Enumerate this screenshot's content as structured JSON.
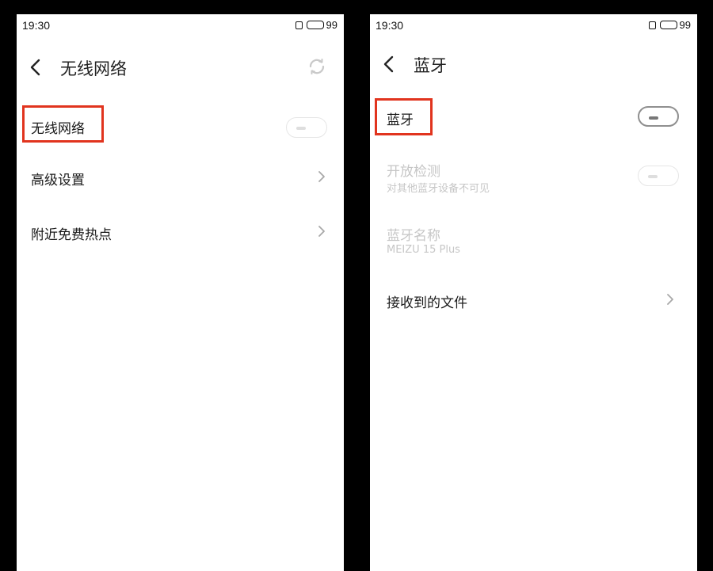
{
  "left_screen": {
    "status_bar": {
      "time": "19:30",
      "battery": "99"
    },
    "title": "无线网络",
    "rows": {
      "wifi_toggle_label": "无线网络",
      "advanced_settings": "高级设置",
      "nearby_hotspots": "附近免费热点"
    },
    "icons": {
      "back": "back-arrow-icon",
      "refresh": "refresh-icon",
      "chevron": "chevron-right-icon"
    }
  },
  "right_screen": {
    "status_bar": {
      "time": "19:30",
      "battery": "99"
    },
    "title": "蓝牙",
    "rows": {
      "bluetooth_toggle_label": "蓝牙",
      "discoverable_label": "开放检测",
      "discoverable_sub": "对其他蓝牙设备不可见",
      "device_name_label": "蓝牙名称",
      "device_name_value": "MEIZU 15 Plus",
      "received_files": "接收到的文件"
    },
    "icons": {
      "back": "back-arrow-icon",
      "chevron": "chevron-right-icon"
    }
  },
  "colors": {
    "highlight": "#e1341e",
    "disabled_text": "#c6c6c6",
    "background": "#000000"
  }
}
